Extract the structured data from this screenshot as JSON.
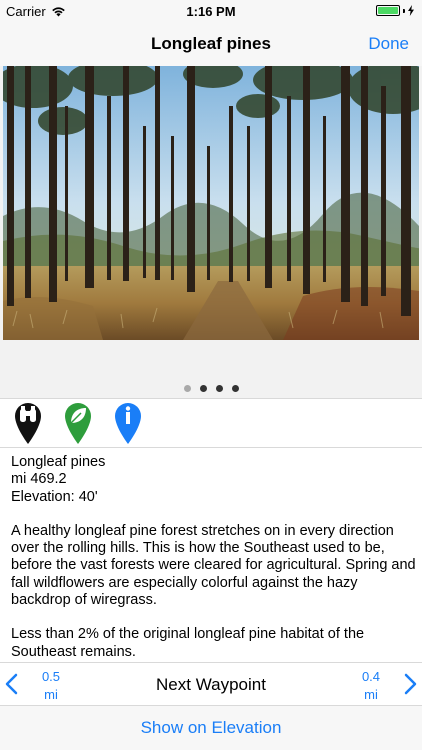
{
  "status_bar": {
    "carrier": "Carrier",
    "time": "1:16 PM",
    "battery_level": 1.0
  },
  "nav": {
    "title": "Longleaf pines",
    "done_label": "Done"
  },
  "photo": {
    "page_count": 4,
    "current_page": 1
  },
  "icons": [
    "binoculars-icon",
    "leaf-icon",
    "info-icon"
  ],
  "colors": {
    "accent": "#1a7ef7",
    "leaf_green": "#2e9d3c",
    "info_blue": "#1a7ef7"
  },
  "details": {
    "name": "Longleaf pines",
    "mile": "mi 469.2",
    "elevation": "Elevation: 40'",
    "paragraph1": "A healthy longleaf pine forest stretches on in every direction over the rolling hills. This is how the Southeast used to be, before the vast forests were cleared for agricultural. Spring and fall wildflowers are especially colorful against the hazy backdrop of wiregrass.",
    "paragraph2": "Less than 2% of the original longleaf pine habitat of the Southeast remains."
  },
  "waypoint": {
    "prev_distance": "0.5",
    "prev_unit": "mi",
    "title": "Next Waypoint",
    "next_distance": "0.4",
    "next_unit": "mi"
  },
  "elevation_button": "Show on Elevation"
}
